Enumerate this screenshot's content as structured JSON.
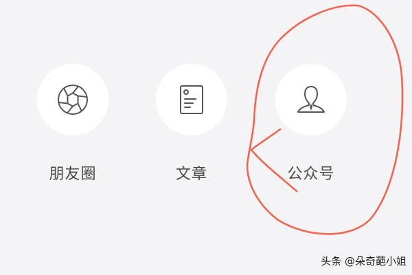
{
  "share_panel": {
    "items": [
      {
        "label": "朋友圈",
        "icon": "shutter-icon"
      },
      {
        "label": "文章",
        "icon": "document-icon"
      },
      {
        "label": "公众号",
        "icon": "person-icon"
      }
    ]
  },
  "annotation": {
    "color": "#f26552",
    "shape": "hand-drawn-circle"
  },
  "watermark": {
    "text": "头条 @朵奇葩小姐"
  },
  "colors": {
    "background": "#f4f4f6",
    "circle": "#ffffff",
    "label": "#4a4a4a",
    "icon": "#555555"
  }
}
